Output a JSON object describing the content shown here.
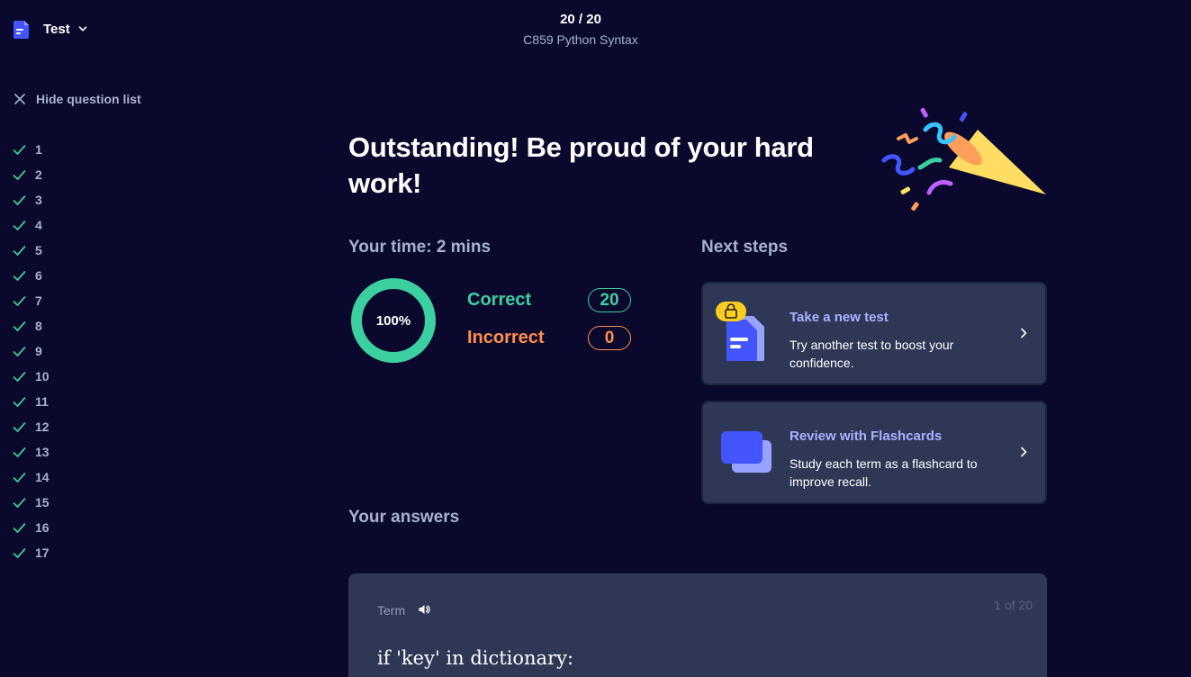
{
  "header": {
    "mode_label": "Test",
    "progress_count": "20 / 20",
    "set_title": "C859 Python Syntax"
  },
  "sidebar": {
    "hide_label": "Hide question list",
    "questions": [
      "1",
      "2",
      "3",
      "4",
      "5",
      "6",
      "7",
      "8",
      "9",
      "10",
      "11",
      "12",
      "13",
      "14",
      "15",
      "16",
      "17"
    ]
  },
  "results": {
    "headline": "Outstanding! Be proud of your hard work!",
    "time_label": "Your time: 2 mins",
    "score_percent": "100%",
    "score_fraction": 1.0,
    "correct_label": "Correct",
    "correct_count": "20",
    "incorrect_label": "Incorrect",
    "incorrect_count": "0"
  },
  "next_steps": {
    "label": "Next steps",
    "cards": [
      {
        "title": "Take a new test",
        "description": "Try another test to boost your confidence."
      },
      {
        "title": "Review with Flashcards",
        "description": "Study each term as a flashcard to improve recall."
      }
    ]
  },
  "answers": {
    "label": "Your answers",
    "term_label": "Term",
    "counter": "1 of 20",
    "term_text": "if 'key' in dictionary:"
  },
  "colors": {
    "background": "#0a092d",
    "card": "#2e3856",
    "correct": "#3ccfa0",
    "incorrect": "#ff8f4c",
    "accent": "#4255ff",
    "link": "#a8b1ff"
  }
}
